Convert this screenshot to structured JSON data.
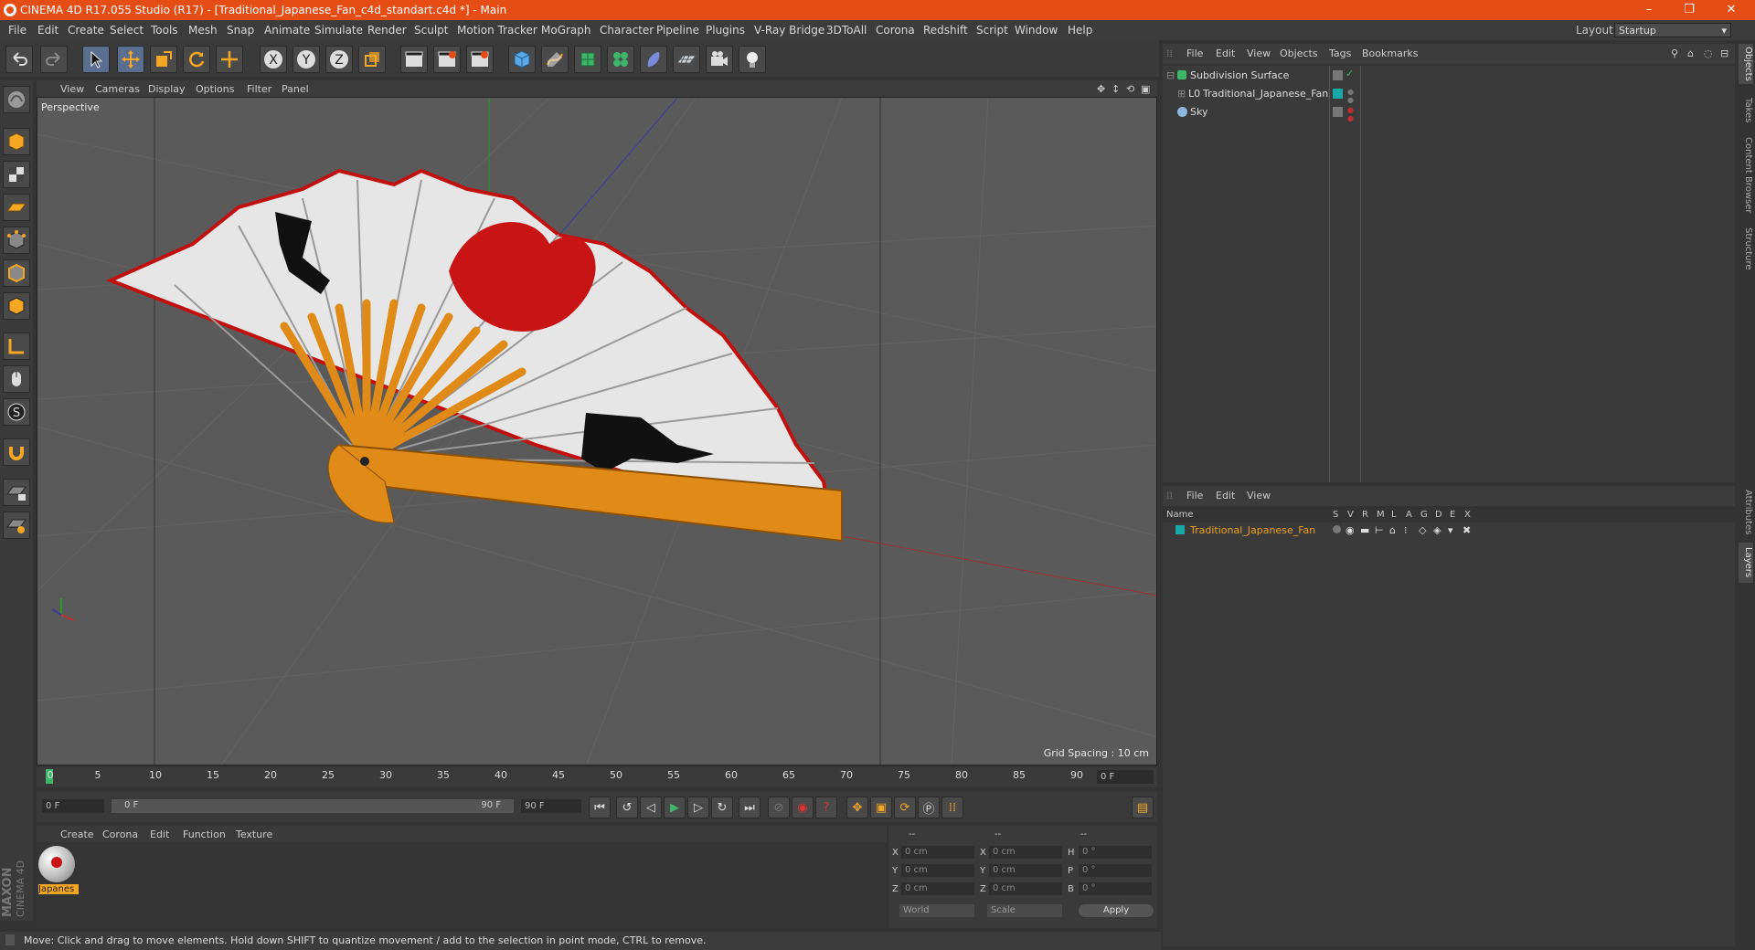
{
  "window": {
    "title": "CINEMA 4D R17.055 Studio (R17) - [Traditional_Japanese_Fan_c4d_standart.c4d *] - Main",
    "minimize": "–",
    "maximize": "❐",
    "close": "✕"
  },
  "menubar": {
    "items": [
      "File",
      "Edit",
      "Create",
      "Select",
      "Tools",
      "Mesh",
      "Snap",
      "Animate",
      "Simulate",
      "Render",
      "Sculpt",
      "Motion Tracker",
      "MoGraph",
      "Character",
      "Pipeline",
      "Plugins",
      "V-Ray Bridge",
      "3DToAll",
      "Corona",
      "Redshift",
      "Script",
      "Window",
      "Help"
    ],
    "layout_label": "Layout:",
    "layout_value": "Startup"
  },
  "viewport": {
    "menu": [
      "View",
      "Cameras",
      "Display",
      "Options",
      "Filter",
      "Panel"
    ],
    "camera_label": "Perspective",
    "grid_spacing": "Grid Spacing : 10 cm"
  },
  "timeline": {
    "ticks": [
      "0",
      "5",
      "10",
      "15",
      "20",
      "25",
      "30",
      "35",
      "40",
      "45",
      "50",
      "55",
      "60",
      "65",
      "70",
      "75",
      "80",
      "85",
      "90"
    ],
    "current_frame": "0 F",
    "start_field": "0 F",
    "range_start": "0 F",
    "range_end": "90 F",
    "end_field": "90 F"
  },
  "material_manager": {
    "menu": [
      "Create",
      "Corona",
      "Edit",
      "Function",
      "Texture"
    ],
    "materials": [
      {
        "name": "Japanes"
      }
    ]
  },
  "coordinates": {
    "headers": [
      "--",
      "--",
      "--"
    ],
    "rows": [
      {
        "pos_label": "X",
        "pos": "0 cm",
        "size_label": "X",
        "size": "0 cm",
        "rot_label": "H",
        "rot": "0 °"
      },
      {
        "pos_label": "Y",
        "pos": "0 cm",
        "size_label": "Y",
        "size": "0 cm",
        "rot_label": "P",
        "rot": "0 °"
      },
      {
        "pos_label": "Z",
        "pos": "0 cm",
        "size_label": "Z",
        "size": "0 cm",
        "rot_label": "B",
        "rot": "0 °"
      }
    ],
    "mode1": "World",
    "mode2": "Scale",
    "apply": "Apply"
  },
  "status": "Move: Click and drag to move elements. Hold down SHIFT to quantize movement / add to the selection in point mode, CTRL to remove.",
  "object_manager": {
    "menu": [
      "File",
      "Edit",
      "View",
      "Objects",
      "Tags",
      "Bookmarks"
    ],
    "objects": [
      {
        "name": "Subdivision Surface",
        "color": "#3fb56a"
      },
      {
        "name": "Traditional_Japanese_Fan",
        "color": "#c8c8c8"
      },
      {
        "name": "Sky",
        "color": "#8fb6e0"
      }
    ]
  },
  "layer_manager": {
    "menu": [
      "File",
      "Edit",
      "View"
    ],
    "header_name": "Name",
    "columns": [
      "S",
      "V",
      "R",
      "M",
      "L",
      "A",
      "G",
      "D",
      "E",
      "X"
    ],
    "layers": [
      {
        "name": "Traditional_Japanese_Fan",
        "color": "#18a8a8"
      }
    ]
  },
  "right_tabs": [
    "Objects",
    "Takes",
    "Content Browser",
    "Structure",
    "Attributes",
    "Layers"
  ],
  "brand": {
    "maxon": "MAXON",
    "product": "CINEMA 4D"
  },
  "colors": {
    "accent": "#e54d15",
    "layer_text": "#f0a020",
    "fan_wood": "#e08a18",
    "fan_red": "#c81414"
  }
}
